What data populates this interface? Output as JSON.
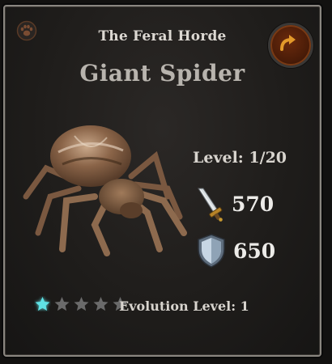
{
  "faction": {
    "name": "The Feral Horde",
    "icon": "paw-icon"
  },
  "creature": {
    "name": "Giant Spider",
    "image": "giant-spider-illustration"
  },
  "actions": {
    "share_icon": "curved-arrow-icon"
  },
  "level": {
    "label": "Level:",
    "current": 1,
    "max": 20,
    "text": "1/20",
    "display": "Level: 1/20"
  },
  "stats": {
    "attack": {
      "icon": "sword-icon",
      "value": "570"
    },
    "defense": {
      "icon": "shield-icon",
      "value": "650"
    }
  },
  "evolution": {
    "stars_total": 5,
    "stars_filled": 1,
    "filled_color": "#5fe3e6",
    "empty_color": "#6a6a6a",
    "label": "Evolution Level: 1"
  },
  "colors": {
    "panel_bg": "#1f1d1b",
    "border": "#8a8680",
    "button_fill": "#4a1c08",
    "arrow": "#e39a2a"
  }
}
